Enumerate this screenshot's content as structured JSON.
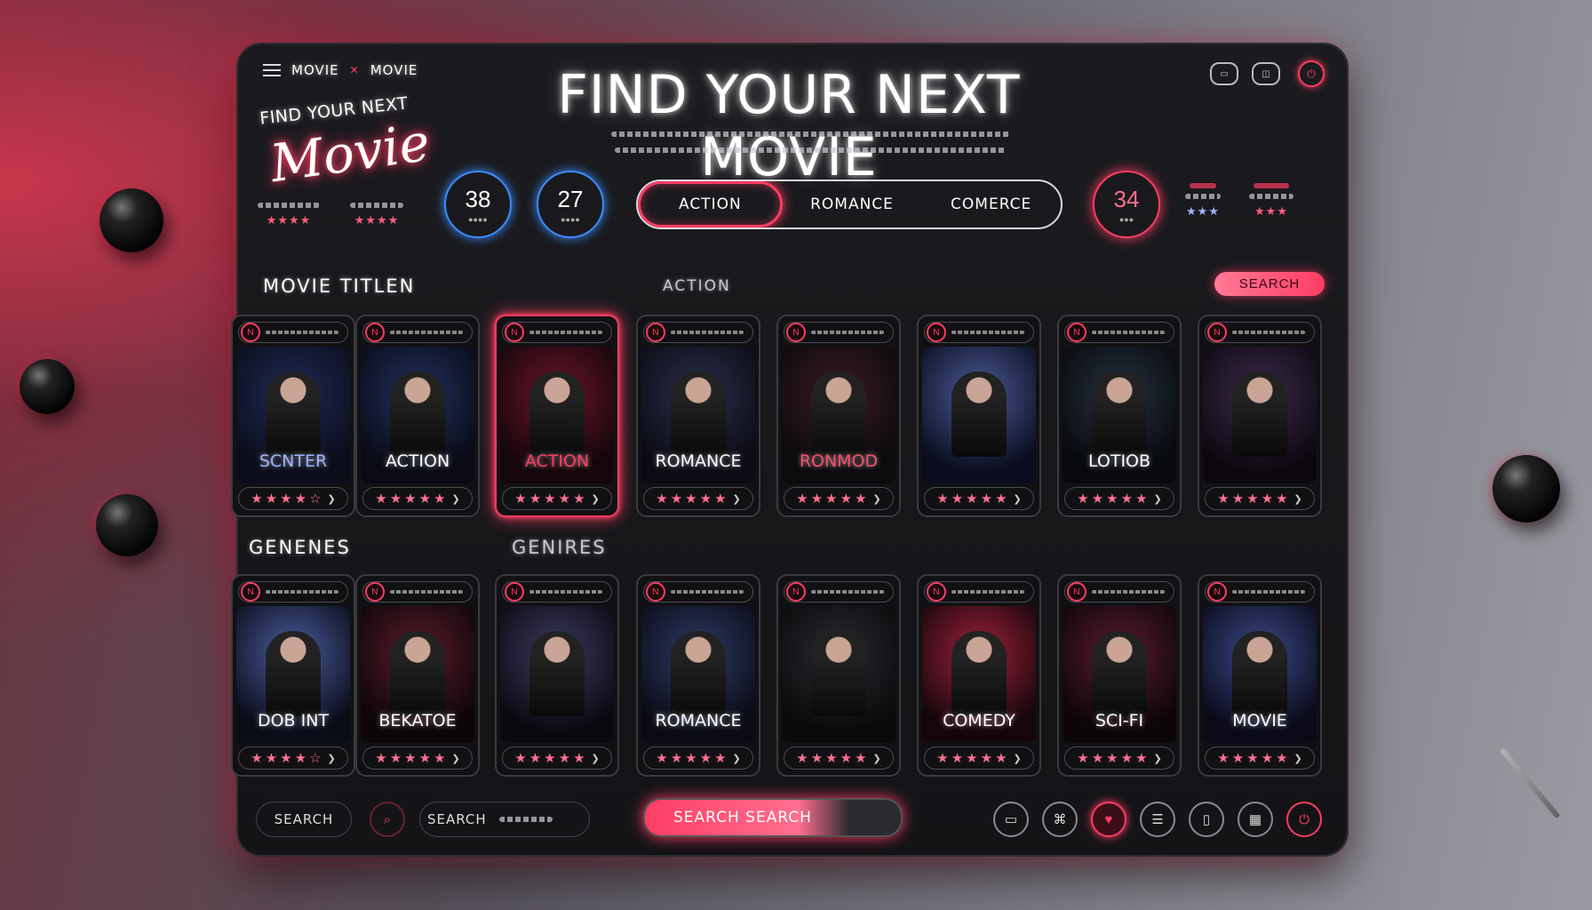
{
  "brand": {
    "left": "MOVIE",
    "right": "MOVIE"
  },
  "hero": {
    "small_title": "FIND YOUR NEXT",
    "script_title": "Movie",
    "main_title": "FIND YOUR NEXT MOVIE"
  },
  "stats": [
    {
      "value": "38",
      "color": "#3d8cff"
    },
    {
      "value": "27",
      "color": "#3d8cff"
    },
    {
      "value": "34",
      "color": "#ff3d63"
    }
  ],
  "genre_nav": {
    "items": [
      "ACTION",
      "ROMANCE",
      "COMERCE"
    ],
    "active_index": 0
  },
  "ratings_small": {
    "left_count": 4,
    "right_count": 4
  },
  "sections": {
    "row1_title": "MOVIE TITLEN",
    "row1_filter": "ACTION",
    "row2_title": "GENENES",
    "row2_filter": "GENIRES"
  },
  "search_button": "SEARCH",
  "row1": [
    {
      "title": "SCNTER",
      "palette": [
        "#1e2a55",
        "#0b0d1a"
      ],
      "accent": "#9fb4ff",
      "stars": 4,
      "selected": false
    },
    {
      "title": "ACTION",
      "palette": [
        "#20305f",
        "#090a14"
      ],
      "accent": "#ffffff",
      "stars": 5,
      "selected": false
    },
    {
      "title": "ACTION",
      "palette": [
        "#6a1428",
        "#14060a"
      ],
      "accent": "#ff3d63",
      "stars": 5,
      "selected": true
    },
    {
      "title": "ROMANCE",
      "palette": [
        "#2a2e4a",
        "#0b0b14"
      ],
      "accent": "#ffffff",
      "stars": 5,
      "selected": false
    },
    {
      "title": "RONMOD",
      "palette": [
        "#3a1a22",
        "#0b0a0d"
      ],
      "accent": "#ff4d6a",
      "stars": 5,
      "selected": false
    },
    {
      "title": "",
      "palette": [
        "#4a5c9a",
        "#0a0d1d"
      ],
      "accent": "#ffffff",
      "stars": 5,
      "selected": false
    },
    {
      "title": "LOTIOB",
      "palette": [
        "#26303e",
        "#07090d"
      ],
      "accent": "#ffffff",
      "stars": 5,
      "selected": false
    },
    {
      "title": "",
      "palette": [
        "#3a2a4a",
        "#0d0810"
      ],
      "accent": "#ff3d63",
      "stars": 5,
      "selected": false
    }
  ],
  "row2": [
    {
      "title": "DOB INT",
      "palette": [
        "#4a5ea0",
        "#0a0c18"
      ],
      "accent": "#ffffff",
      "stars": 4,
      "selected": false
    },
    {
      "title": "BEKATOE",
      "palette": [
        "#5a1a2a",
        "#0c0608"
      ],
      "accent": "#ffffff",
      "stars": 5,
      "selected": false
    },
    {
      "title": "",
      "palette": [
        "#3c3a60",
        "#0a0910"
      ],
      "accent": "#ffffff",
      "stars": 5,
      "selected": false
    },
    {
      "title": "ROMANCE",
      "palette": [
        "#2c3a66",
        "#0a0b14"
      ],
      "accent": "#ffffff",
      "stars": 5,
      "selected": false
    },
    {
      "title": "",
      "palette": [
        "#2a2a30",
        "#0a0a0c"
      ],
      "accent": "#ffffff",
      "stars": 5,
      "selected": false
    },
    {
      "title": "COMEDY",
      "palette": [
        "#a0203c",
        "#14060a"
      ],
      "accent": "#ffffff",
      "stars": 5,
      "selected": false
    },
    {
      "title": "SCI-FI",
      "palette": [
        "#5a1a2e",
        "#0c0608"
      ],
      "accent": "#ffffff",
      "stars": 5,
      "selected": false
    },
    {
      "title": "MOVIE",
      "palette": [
        "#3a4a8a",
        "#0a0a18"
      ],
      "accent": "#ffffff",
      "stars": 5,
      "selected": false
    }
  ],
  "bottom": {
    "search_left": "SEARCH",
    "search_mid": "SEARCH",
    "search_cta": "SEARCH SEARCH"
  },
  "bottom_icons": [
    "tv-icon",
    "gamepad-icon",
    "heart-icon",
    "list-icon",
    "bookmark-icon",
    "grid-icon",
    "power-icon"
  ],
  "colors": {
    "accent": "#ff3d63",
    "blue": "#3d8cff",
    "panel": "#18181b"
  }
}
